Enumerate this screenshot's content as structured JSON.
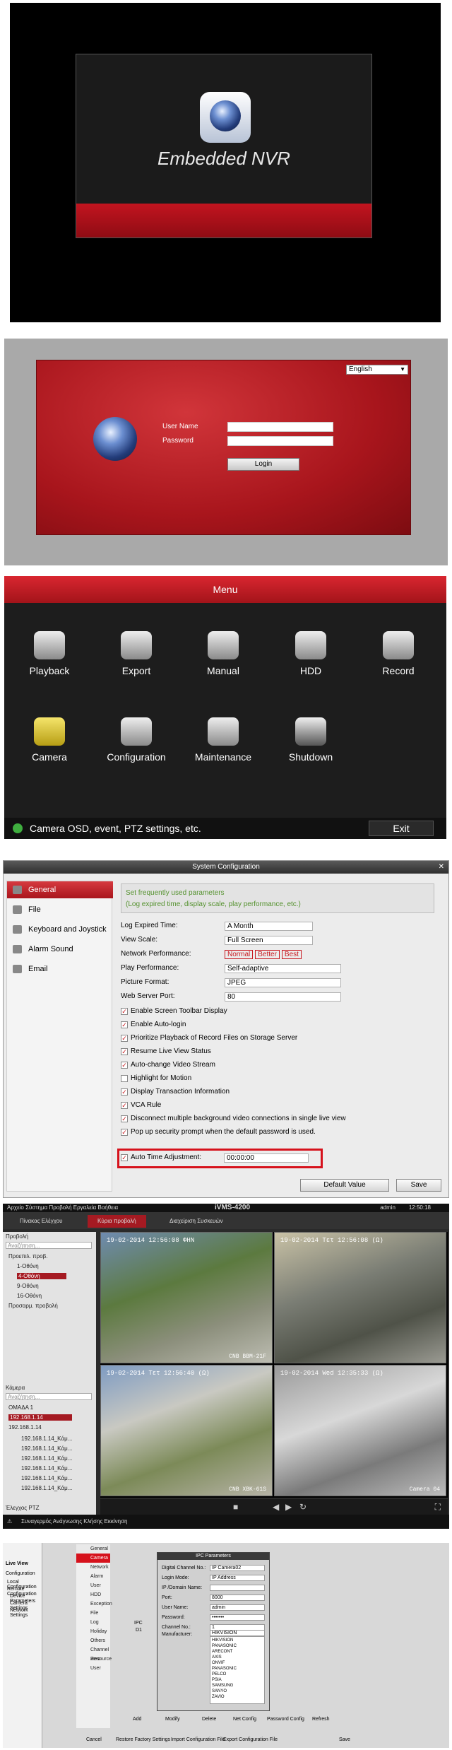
{
  "splash": {
    "title": "Embedded NVR"
  },
  "login": {
    "language": "English",
    "user_name_label": "User Name",
    "password_label": "Password",
    "login_button": "Login"
  },
  "menu": {
    "title": "Menu",
    "items": [
      "Playback",
      "Export",
      "Manual",
      "HDD",
      "Record",
      "Camera",
      "Configuration",
      "Maintenance",
      "Shutdown"
    ],
    "status_tip": "Camera OSD, event, PTZ settings, etc.",
    "exit_button": "Exit"
  },
  "sysconf": {
    "title": "System Configuration",
    "nav": [
      "General",
      "File",
      "Keyboard and Joystick",
      "Alarm Sound",
      "Email"
    ],
    "info_line1": "Set frequently used parameters",
    "info_line2": "(Log expired time, display scale, play performance, etc.)",
    "fields": {
      "log_expired_label": "Log Expired Time:",
      "log_expired_value": "A Month",
      "view_scale_label": "View Scale:",
      "view_scale_value": "Full Screen",
      "network_label": "Network Performance:",
      "network_opts": [
        "Normal",
        "Better",
        "Best"
      ],
      "play_label": "Play Performance:",
      "play_value": "Self-adaptive",
      "picture_label": "Picture Format:",
      "picture_value": "JPEG",
      "web_port_label": "Web Server Port:",
      "web_port_value": "80"
    },
    "checks": [
      "Enable Screen Toolbar Display",
      "Enable Auto-login",
      "Prioritize Playback of Record Files on Storage Server",
      "Resume Live View Status",
      "Auto-change Video Stream",
      "Highlight for Motion",
      "Display Transaction Information",
      "VCA Rule",
      "Disconnect multiple background video connections in single live view",
      "Pop up security prompt when the default password is used."
    ],
    "auto_time_label": "Auto Time Adjustment:",
    "auto_time_value": "00:00:00",
    "default_button": "Default Value",
    "save_button": "Save"
  },
  "ivms": {
    "menubar": "Αρχείο   Σύστημα   Προβολή   Εργαλεία   Βοήθεια",
    "app_title": "iVMS-4200",
    "user": "admin",
    "clock": "12:50:18",
    "tabs": [
      "Πίνακας Ελέγχου",
      "Κύρια προβολή",
      "Διαχείριση Συσκευών"
    ],
    "view_title": "Προβολή",
    "search_placeholder": "Αναζήτηση...",
    "views": [
      "Προεπιλ. προβ.",
      "1-Οθόνη",
      "4-Οθόνη",
      "9-Οθόνη",
      "16-Οθόνη",
      "Προσαρμ. προβολή"
    ],
    "camera_title": "Κάμερα",
    "groups": [
      "ΟΜΑΔΑ 1",
      "192.168.1.14",
      "192.168.1.14"
    ],
    "cams": [
      "192.168.1.14_Kάμ...",
      "192.168.1.14_Kάμ...",
      "192.168.1.14_Kάμ...",
      "192.168.1.14_Kάμ...",
      "192.168.1.14_Kάμ...",
      "192.168.1.14_Kάμ..."
    ],
    "feeds": [
      {
        "ts": "19-02-2014 12:56:08 ΦΗΝ",
        "label": "CNB BBM-21F"
      },
      {
        "ts": "19-02-2014 Τετ 12:56:08 (Ω)",
        "label": ""
      },
      {
        "ts": "19-02-2014 Τετ 12:56:40 (Ω)",
        "label": "CNB XBK-61S"
      },
      {
        "ts": "19-02-2014 Wed 12:35:33 (Ω)",
        "label": "Camera 04"
      }
    ],
    "ptz_label": "Έλεγχος PTZ",
    "status_bar": "Συναγερμός Ανάγνωσης Κλήσης Εκκίνηση"
  },
  "ipc": {
    "title": "IPC Parameters",
    "left_nav": [
      "Live View",
      "Configuration",
      "Local Configuration",
      "Remote Configuration",
      "Device Parameters",
      "Camera Settings",
      "Network Settings"
    ],
    "menu_nav": [
      "General",
      "Camera",
      "Network",
      "Alarm",
      "User",
      "HDD",
      "Exception",
      "File",
      "Log",
      "Holiday",
      "Others",
      "Channel Zero",
      "Resource User"
    ],
    "rows": [
      {
        "label": "Digital Channel No.:",
        "value": "IP Camera02"
      },
      {
        "label": "Login Mode:",
        "value": "IP Address"
      },
      {
        "label": "IP /Domain Name:",
        "value": ""
      },
      {
        "label": "Port:",
        "value": "8000"
      },
      {
        "label": "User Name:",
        "value": "admin"
      },
      {
        "label": "Password:",
        "value": "•••••••"
      },
      {
        "label": "Channel No.:",
        "value": "1"
      },
      {
        "label": "Manufacturer:",
        "value": "HIKVISION"
      }
    ],
    "manufacturers": [
      "HIKVISION",
      "PANASONIC",
      "ARECONT",
      "AXIS",
      "ONVIF",
      "PANASONIC",
      "PELCO",
      "PSIA",
      "SAMSUNG",
      "SANYO",
      "ZAVIO"
    ],
    "buttons": [
      "Add",
      "Modify",
      "Delete",
      "Net Config",
      "Password Config",
      "Refresh"
    ],
    "footer_buttons": [
      "Cancel",
      "Restore Factory Settings",
      "Import Configuration File",
      "Export Configuration File",
      "Save"
    ],
    "ipc_label": "IPC",
    "ipc_value": "D1"
  }
}
